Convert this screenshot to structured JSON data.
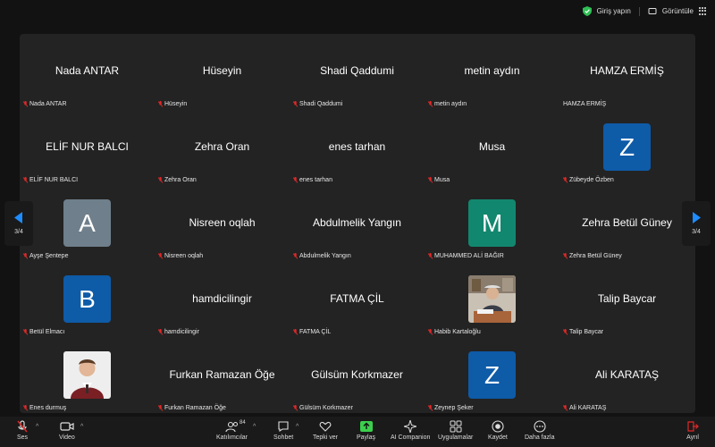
{
  "topbar": {
    "signin_label": "Giriş yapın",
    "view_label": "Görüntüle"
  },
  "pager": {
    "left": "3/4",
    "right": "3/4"
  },
  "tiles": [
    {
      "name": "Nada ANTAR",
      "label": "Nada ANTAR",
      "muted": true
    },
    {
      "name": "Hüseyin",
      "label": "Hüseyin",
      "muted": true
    },
    {
      "name": "Shadi Qaddumi",
      "label": "Shadi Qaddumi",
      "muted": true
    },
    {
      "name": "metin aydın",
      "label": "metin aydın",
      "muted": true
    },
    {
      "name": "HAMZA ERMİŞ",
      "label": "HAMZA ERMİŞ",
      "muted": false
    },
    {
      "name": "ELİF NUR BALCI",
      "label": "ELİF NUR BALCI",
      "muted": true
    },
    {
      "name": "Zehra Oran",
      "label": "Zehra Oran",
      "muted": true
    },
    {
      "name": "enes tarhan",
      "label": "enes tarhan",
      "muted": true
    },
    {
      "name": "Musa",
      "label": "Musa",
      "muted": true
    },
    {
      "avatar": "Z",
      "color": "#0e5ba8",
      "label": "Zübeyde Özben",
      "muted": true
    },
    {
      "avatar": "A",
      "color": "#6f7f8b",
      "label": "Ayşe Şentepe",
      "muted": true
    },
    {
      "name": "Nisreen oqlah",
      "label": "Nisreen oqlah",
      "muted": true
    },
    {
      "name": "Abdulmelik Yangın",
      "label": "Abdulmelik Yangın",
      "muted": true
    },
    {
      "avatar": "M",
      "color": "#12876f",
      "label": "MUHAMMED ALİ BAĞIR",
      "muted": true
    },
    {
      "name": "Zehra Betül Güney",
      "label": "Zehra Betül Güney",
      "muted": true
    },
    {
      "avatar": "B",
      "color": "#0e5ba8",
      "label": "Betül Elmacı",
      "muted": true
    },
    {
      "name": "hamdicilingir",
      "label": "hamdicilingir",
      "muted": true
    },
    {
      "name": "FATMA ÇİL",
      "label": "FATMA ÇİL",
      "muted": true
    },
    {
      "photo": "older-man",
      "label": "Habib Kartaloğlu",
      "muted": true
    },
    {
      "name": "Talip Baycar",
      "label": "Talip Baycar",
      "muted": true
    },
    {
      "photo": "young-man",
      "label": "Enes durmuş",
      "muted": true
    },
    {
      "name": "Furkan Ramazan Öğe",
      "label": "Furkan Ramazan Öğe",
      "muted": true
    },
    {
      "name": "Gülsüm Korkmazer",
      "label": "Gülsüm Korkmazer",
      "muted": true
    },
    {
      "avatar": "Z",
      "color": "#0e5ba8",
      "label": "Zeynep Şeker",
      "muted": true
    },
    {
      "name": "Ali KARATAŞ",
      "label": "Ali KARATAŞ",
      "muted": true
    }
  ],
  "toolbar": {
    "audio": "Ses",
    "video": "Video",
    "participants": "Katılımcılar",
    "participants_count": "84",
    "chat": "Sohbet",
    "reactions": "Tepki ver",
    "share": "Paylaş",
    "ai": "AI Companion",
    "apps": "Uygulamalar",
    "record": "Kaydet",
    "more": "Daha fazla",
    "leave": "Ayrıl"
  },
  "colors": {
    "share_green": "#3ccf4e",
    "muted_red": "#e02828",
    "stage": "#232323"
  }
}
